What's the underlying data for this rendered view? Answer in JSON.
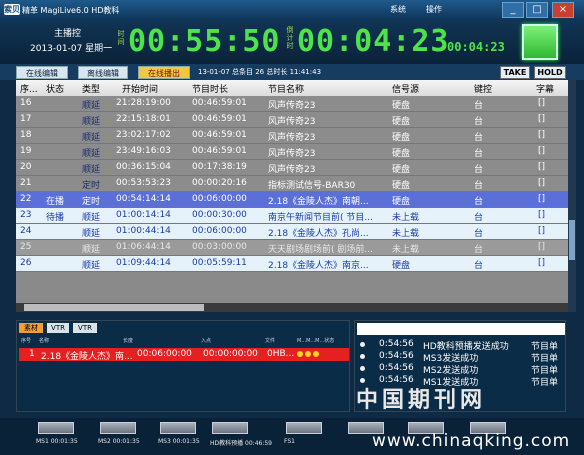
{
  "window": {
    "brand": "索贝",
    "title": "精革 MagiLive6.0  HD教科",
    "menus": [
      "系统",
      "操作"
    ],
    "btn_min": "_",
    "btn_max": "□",
    "btn_close": "×"
  },
  "clock": {
    "mode": "主播控",
    "date": "2013-01-07  星期一",
    "time_label": [
      "时",
      "间"
    ],
    "time": "00:55:50",
    "countdown_label": [
      "倒",
      "计",
      "时"
    ],
    "countdown": "00:04:23",
    "countdown_small": "00:04:23"
  },
  "tabs": [
    "在线编辑",
    "离线编辑",
    "在线播出"
  ],
  "active_tab": "在线播出",
  "tab_info": "13-01-07   总条目 26  总时长 11:41:43",
  "buttons": {
    "take": "TAKE",
    "hold": "HOLD"
  },
  "grid": {
    "columns": [
      "序...",
      "状态",
      "类型",
      "开始时间",
      "节目时长",
      "节目名称",
      "信号源",
      "键控",
      "字幕"
    ],
    "rows": [
      {
        "no": "16",
        "state": "",
        "type": "顺延",
        "start": "21:28:19:00",
        "dur": "00:46:59:01",
        "name": "风声传奇23",
        "src": "硬盘",
        "key": "台",
        "sub": "[]",
        "cls": "done"
      },
      {
        "no": "17",
        "state": "",
        "type": "顺延",
        "start": "22:15:18:01",
        "dur": "00:46:59:01",
        "name": "风声传奇23",
        "src": "硬盘",
        "key": "台",
        "sub": "[]",
        "cls": "done"
      },
      {
        "no": "18",
        "state": "",
        "type": "顺延",
        "start": "23:02:17:02",
        "dur": "00:46:59:01",
        "name": "风声传奇23",
        "src": "硬盘",
        "key": "台",
        "sub": "[]",
        "cls": "done"
      },
      {
        "no": "19",
        "state": "",
        "type": "顺延",
        "start": "23:49:16:03",
        "dur": "00:46:59:01",
        "name": "风声传奇23",
        "src": "硬盘",
        "key": "台",
        "sub": "[]",
        "cls": "done"
      },
      {
        "no": "20",
        "state": "",
        "type": "顺延",
        "start": "00:36:15:04",
        "dur": "00:17:38:19",
        "name": "风声传奇23",
        "src": "硬盘",
        "key": "台",
        "sub": "[]",
        "cls": "done"
      },
      {
        "no": "21",
        "state": "",
        "type": "定时",
        "start": "00:53:53:23",
        "dur": "00:00:20:16",
        "name": "指标测试信号-BAR30",
        "src": "硬盘",
        "key": "台",
        "sub": "[]",
        "cls": "done"
      },
      {
        "no": "22",
        "state": "在播",
        "type": "定时",
        "start": "00:54:14:14",
        "dur": "00:06:00:00",
        "name": "2.18《金陵人杰》南朝...",
        "src": "硬盘",
        "key": "台",
        "sub": "[]",
        "cls": "onair"
      },
      {
        "no": "23",
        "state": "待播",
        "type": "顺延",
        "start": "01:00:14:14",
        "dur": "00:00:30:00",
        "name": "南京午新闻节目前( 节目...",
        "src": "未上载",
        "key": "台",
        "sub": "[]",
        "cls": "next"
      },
      {
        "no": "24",
        "state": "",
        "type": "顺延",
        "start": "01:00:44:14",
        "dur": "00:06:00:00",
        "name": "2.18《金陵人杰》孔尚...",
        "src": "未上载",
        "key": "台",
        "sub": "[]",
        "cls": "queued"
      },
      {
        "no": "25",
        "state": "",
        "type": "顺延",
        "start": "01:06:44:14",
        "dur": "00:03:00:00",
        "name": "天天剧场剧场前( 剧场前...",
        "src": "未上载",
        "key": "台",
        "sub": "[]",
        "cls": "gray"
      },
      {
        "no": "26",
        "state": "",
        "type": "顺延",
        "start": "01:09:44:14",
        "dur": "00:05:59:11",
        "name": "2.18《金陵人杰》南京...",
        "src": "硬盘",
        "key": "台",
        "sub": "[]",
        "cls": "queued"
      }
    ]
  },
  "lower_left": {
    "tabs": [
      "素材",
      "VTR",
      "VTR"
    ],
    "headers": [
      "序号",
      "名称",
      "长度",
      "入点",
      "文件",
      "M...M...M...状态"
    ],
    "row": {
      "no": "1",
      "name": "2.18《金陵人杰》南...",
      "len": "00:06:00:00",
      "in": "00:00:00:00",
      "file": "0HB..."
    }
  },
  "messages": [
    {
      "time": "0:54:56",
      "text": "HD教科预播发送成功",
      "tag": "节目单"
    },
    {
      "time": "0:54:56",
      "text": "MS3发送成功",
      "tag": "节目单"
    },
    {
      "time": "0:54:56",
      "text": "MS2发送成功",
      "tag": "节目单"
    },
    {
      "time": "0:54:56",
      "text": "MS1发送成功",
      "tag": "节目单"
    }
  ],
  "watermark": "中国期刊网",
  "watermark_url": "www.chinaqking.com",
  "devices": [
    {
      "label": "MS1 00:01:35"
    },
    {
      "label": "MS2 00:01:35"
    },
    {
      "label": "MS3 00:01:35"
    },
    {
      "label": "HD教科预播 00:46:59"
    },
    {
      "label": "FS1"
    }
  ]
}
